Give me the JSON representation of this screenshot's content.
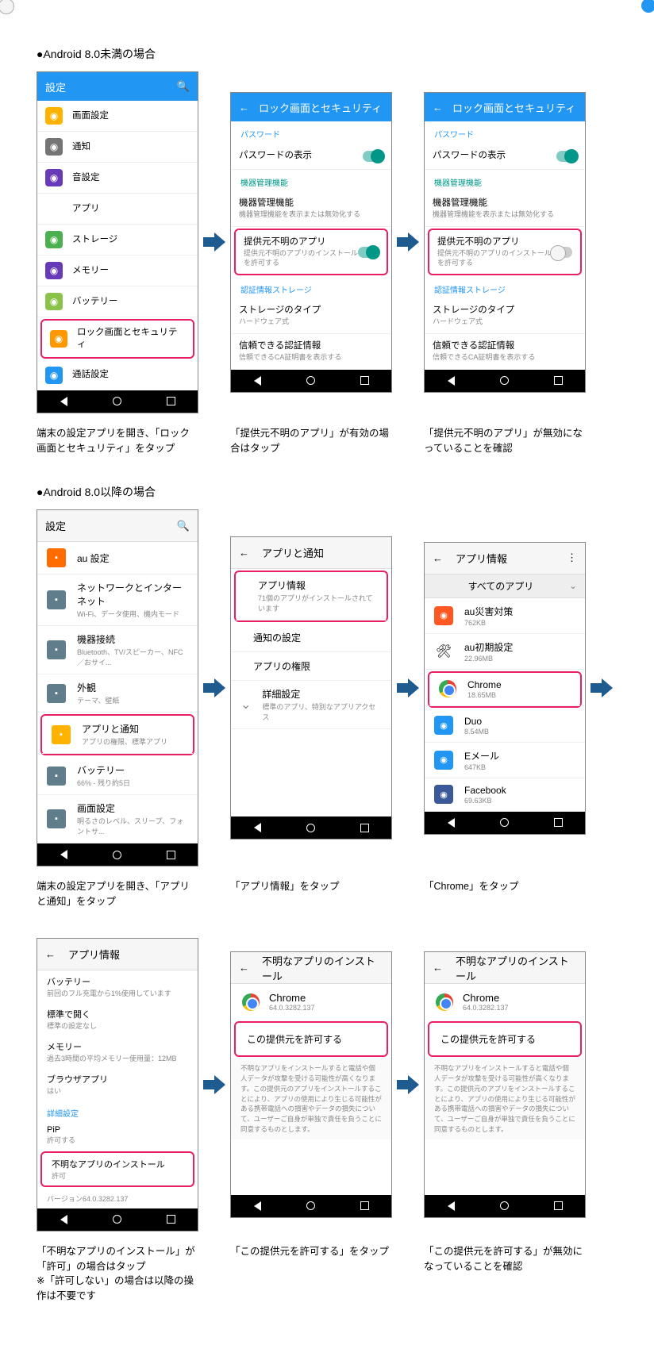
{
  "section1_title": "●Android 8.0未満の場合",
  "section2_title": "●Android 8.0以降の場合",
  "p1": {
    "header": "設定",
    "items": [
      {
        "label": "画面設定",
        "color": "#ffb300"
      },
      {
        "label": "通知",
        "color": "#757575"
      },
      {
        "label": "音設定",
        "color": "#673ab7"
      },
      {
        "label": "アプリ",
        "color": "#fff"
      },
      {
        "label": "ストレージ",
        "color": "#4caf50"
      },
      {
        "label": "メモリー",
        "color": "#673ab7"
      },
      {
        "label": "バッテリー",
        "color": "#8bc34a"
      },
      {
        "label": "ロック画面とセキュリティ",
        "color": "#ff9800",
        "hl": true
      },
      {
        "label": "通話設定",
        "color": "#2196f3"
      }
    ]
  },
  "p2": {
    "header": "ロック画面とセキュリティ",
    "s_pwd": "パスワード",
    "pwd_show": "パスワードの表示",
    "s_dev": "機器管理機能",
    "dev_mgr": "機器管理機能",
    "dev_mgr_sub": "機器管理機能を表示または無効化する",
    "unk": "提供元不明のアプリ",
    "unk_sub": "提供元不明のアプリのインストールを許可する",
    "s_cred": "認証情報ストレージ",
    "st_type": "ストレージのタイプ",
    "st_type_sub": "ハードウェア式",
    "cred": "信頼できる認証情報",
    "cred_sub": "信頼できるCA証明書を表示する"
  },
  "cap1a": "端末の設定アプリを開き、「ロック画面とセキュリティ」をタップ",
  "cap1b": "「提供元不明のアプリ」が有効の場合はタップ",
  "cap1c": "「提供元不明のアプリ」が無効になっていることを確認",
  "g1": {
    "header": "設定",
    "items": [
      {
        "label": "au 設定",
        "color": "#ff6d00"
      },
      {
        "label": "ネットワークとインターネット",
        "sub": "Wi-Fi、データ使用、機内モード"
      },
      {
        "label": "機器接続",
        "sub": "Bluetooth、TV/スピーカー、NFC／おサイ..."
      },
      {
        "label": "外観",
        "sub": "テーマ、壁紙"
      },
      {
        "label": "アプリと通知",
        "sub": "アプリの権限、標準アプリ",
        "hl": true,
        "color": "#ffb300"
      },
      {
        "label": "バッテリー",
        "sub": "66% - 残り約5日"
      },
      {
        "label": "画面設定",
        "sub": "明るさのレベル、スリープ、フォントサ..."
      }
    ]
  },
  "g2": {
    "header": "アプリと通知",
    "info": "アプリ情報",
    "info_sub": "71個のアプリがインストールされています",
    "notif": "通知の設定",
    "perm": "アプリの権限",
    "adv": "詳細設定",
    "adv_sub": "標準のアプリ、特別なアプリアクセス"
  },
  "g3": {
    "header": "アプリ情報",
    "all": "すべてのアプリ",
    "apps": [
      {
        "label": "au災害対策",
        "sub": "762KB",
        "color": "#ff5722"
      },
      {
        "label": "au初期設定",
        "sub": "22.96MB"
      },
      {
        "label": "Chrome",
        "sub": "18.65MB",
        "hl": true
      },
      {
        "label": "Duo",
        "sub": "8.54MB",
        "color": "#2196f3"
      },
      {
        "label": "Eメール",
        "sub": "647KB",
        "color": "#2196f3"
      },
      {
        "label": "Facebook",
        "sub": "69.63KB",
        "color": "#3b5998"
      }
    ]
  },
  "cap2a": "端末の設定アプリを開き、「アプリと通知」をタップ",
  "cap2b": "「アプリ情報」をタップ",
  "cap2c": "「Chrome」をタップ",
  "g4": {
    "header": "アプリ情報",
    "bat": "バッテリー",
    "bat_sub": "前回のフル充電から1%使用しています",
    "open": "標準で開く",
    "open_sub": "標準の設定なし",
    "mem": "メモリー",
    "mem_sub": "過去3時間の平均メモリー使用量：12MB",
    "browser": "ブラウザアプリ",
    "browser_sub": "はい",
    "adv": "詳細設定",
    "pip": "PiP",
    "pip_sub": "許可する",
    "unk": "不明なアプリのインストール",
    "unk_sub": "許可",
    "ver": "バージョン64.0.3282.137"
  },
  "g5": {
    "header": "不明なアプリのインストール",
    "app": "Chrome",
    "ver": "64.0.3282.137",
    "allow": "この提供元を許可する",
    "warn": "不明なアプリをインストールすると電話や個人データが攻撃を受ける可能性が高くなります。この提供元のアプリをインストールすることにより、アプリの使用により生じる可能性がある携帯電話への損害やデータの損失について、ユーザーご自身が単独で責任を負うことに同意するものとします。"
  },
  "cap3a": "「不明なアプリのインストール」が「許可」の場合はタップ\n※「許可しない」の場合は以降の操作は不要です",
  "cap3b": "「この提供元を許可する」をタップ",
  "cap3c": "「この提供元を許可する」が無効になっていることを確認"
}
